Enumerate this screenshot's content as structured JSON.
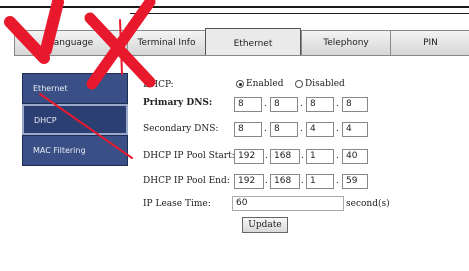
{
  "tabs": [
    {
      "label": "Language"
    },
    {
      "label": "Terminal Info"
    },
    {
      "label": "Ethernet"
    },
    {
      "label": "Telephony"
    },
    {
      "label": "PIN"
    }
  ],
  "sidebar": {
    "items": [
      {
        "label": "Ethernet"
      },
      {
        "label": "DHCP"
      },
      {
        "label": "MAC Filtering"
      }
    ]
  },
  "form": {
    "dhcp_label": "DHCP:",
    "enabled_label": "Enabled",
    "disabled_label": "Disabled",
    "dhcp_value": "Enabled",
    "primary_dns_label": "Primary DNS:",
    "primary_dns": [
      "8",
      "8",
      "8",
      "8"
    ],
    "secondary_dns_label": "Secondary DNS:",
    "secondary_dns": [
      "8",
      "8",
      "4",
      "4"
    ],
    "pool_start_label": "DHCP IP Pool Start:",
    "pool_start": [
      "192",
      "168",
      "1",
      "40"
    ],
    "pool_end_label": "DHCP IP Pool End:",
    "pool_end": [
      "192",
      "168",
      "1",
      "59"
    ],
    "lease_label": "IP Lease Time:",
    "lease_value": "60",
    "lease_unit": "second(s)",
    "update_label": "Update"
  },
  "watermark": {
    "color": "#e8192c"
  }
}
